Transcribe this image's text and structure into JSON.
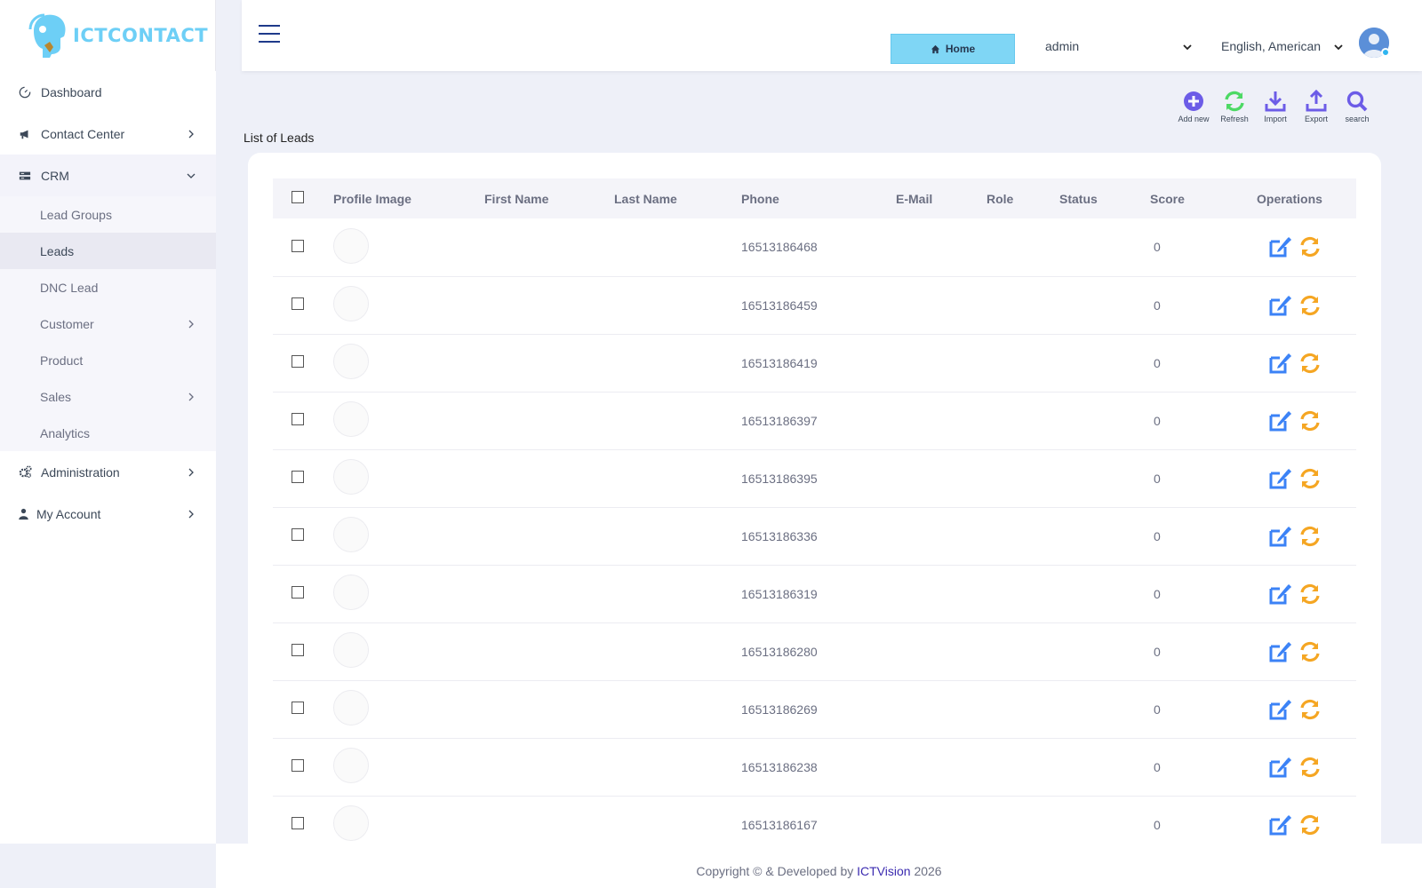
{
  "brand": {
    "name": "ICTCONTACT"
  },
  "sidebar": {
    "items": [
      {
        "label": "Dashboard"
      },
      {
        "label": "Contact Center"
      },
      {
        "label": "CRM"
      },
      {
        "label": "Administration"
      },
      {
        "label": "My Account"
      }
    ],
    "crm_sub": [
      {
        "label": "Lead Groups"
      },
      {
        "label": "Leads"
      },
      {
        "label": "DNC Lead"
      },
      {
        "label": "Customer"
      },
      {
        "label": "Product"
      },
      {
        "label": "Sales"
      },
      {
        "label": "Analytics"
      }
    ]
  },
  "topbar": {
    "home_label": "Home",
    "user_select": "admin",
    "language_select": "English, American"
  },
  "toolbar": {
    "add_new": "Add new",
    "refresh": "Refresh",
    "import": "Import",
    "export": "Export",
    "search": "search"
  },
  "page": {
    "title": "List of Leads"
  },
  "table": {
    "columns": [
      "Profile Image",
      "First Name",
      "Last Name",
      "Phone",
      "E-Mail",
      "Role",
      "Status",
      "Score",
      "Operations"
    ],
    "rows": [
      {
        "phone": "16513186468",
        "score": "0"
      },
      {
        "phone": "16513186459",
        "score": "0"
      },
      {
        "phone": "16513186419",
        "score": "0"
      },
      {
        "phone": "16513186397",
        "score": "0"
      },
      {
        "phone": "16513186395",
        "score": "0"
      },
      {
        "phone": "16513186336",
        "score": "0"
      },
      {
        "phone": "16513186319",
        "score": "0"
      },
      {
        "phone": "16513186280",
        "score": "0"
      },
      {
        "phone": "16513186269",
        "score": "0"
      },
      {
        "phone": "16513186238",
        "score": "0"
      },
      {
        "phone": "16513186167",
        "score": "0"
      }
    ]
  },
  "footer": {
    "prefix": "Copyright © & Developed by ",
    "company": "ICTVision",
    "year": " 2026"
  },
  "colors": {
    "accent": "#7fd6f5",
    "add_icon": "#6c5ce7",
    "refresh_icon": "#4cd964",
    "edit_icon": "#3b82f6",
    "sync_icon": "#f5a623"
  }
}
